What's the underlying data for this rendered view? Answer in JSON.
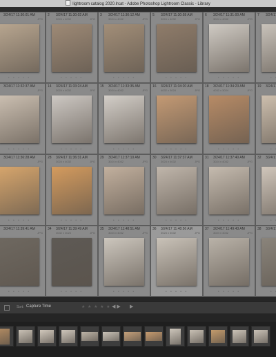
{
  "window": {
    "title": "lightroom catalog 2020.lrcat - Adobe Photoshop Lightroom Classic - Library"
  },
  "grid": {
    "cells": [
      {
        "num": "1",
        "date": "3/24/17 11:30:01 AM",
        "sub": "",
        "fmt": "JPG",
        "thumb": "bust-relief-icon",
        "color": "#b7a58f",
        "selected": false
      },
      {
        "num": "2",
        "date": "3/24/17 11:30:02 AM",
        "sub": "3024 x 4032",
        "fmt": "JPG",
        "thumb": "embracing-sculpture-icon",
        "color": "#9e8a76",
        "selected": false
      },
      {
        "num": "3",
        "date": "3/24/17 11:30:12 AM",
        "sub": "3024 x 4032",
        "fmt": "JPG",
        "thumb": "embracing-sculpture-icon",
        "color": "#a28e78",
        "selected": false
      },
      {
        "num": "5",
        "date": "3/24/17 11:30:58 AM",
        "sub": "3024 x 4032",
        "fmt": "JPG",
        "thumb": "marble-head-icon",
        "color": "#8f7c6a",
        "selected": false
      },
      {
        "num": "6",
        "date": "3/24/17 11:31:00 AM",
        "sub": "3024 x 4032",
        "fmt": "JPG",
        "thumb": "marble-bust-icon",
        "color": "#cfcac3",
        "selected": false
      },
      {
        "num": "7",
        "date": "3/24/17 11:31:...",
        "sub": "",
        "fmt": "",
        "thumb": "marble-bust-icon",
        "color": "#c8c2ba",
        "selected": false
      },
      {
        "num": "13",
        "date": "3/24/17 11:32:37 AM",
        "sub": "",
        "fmt": "JPG",
        "thumb": "bearded-torso-icon",
        "color": "#cbbfb1",
        "selected": false
      },
      {
        "num": "14",
        "date": "3/24/17 11:33:24 AM",
        "sub": "3024 x 4032",
        "fmt": "JPG",
        "thumb": "bronze-griffin-icon",
        "color": "#cdc8c3",
        "selected": false
      },
      {
        "num": "15",
        "date": "3/24/17 11:33:35 AM",
        "sub": "3024 x 4032",
        "fmt": "JPG",
        "thumb": "bronze-griffin-icon",
        "color": "#d3cec8",
        "selected": false
      },
      {
        "num": "16",
        "date": "3/24/17 11:34:20 AM",
        "sub": "4032 x 3024",
        "fmt": "JPG",
        "thumb": "bronze-helmet-icon",
        "color": "#c49a74",
        "selected": false
      },
      {
        "num": "18",
        "date": "3/24/17 11:34:23 AM",
        "sub": "4032 x 3024",
        "fmt": "JPG",
        "thumb": "bronze-helmet-icon",
        "color": "#b78b66",
        "selected": false
      },
      {
        "num": "19",
        "date": "3/24/17 11:...",
        "sub": "",
        "fmt": "",
        "thumb": "marble-torso-icon",
        "color": "#cdbfae",
        "selected": false
      },
      {
        "num": "27",
        "date": "3/24/17 11:36:28 AM",
        "sub": "",
        "fmt": "JPG",
        "thumb": "bronze-head-icon",
        "color": "#d6a56c",
        "selected": false
      },
      {
        "num": "28",
        "date": "3/24/17 11:36:31 AM",
        "sub": "3024 x 4032",
        "fmt": "JPG",
        "thumb": "bronze-head-icon",
        "color": "#d49b5e",
        "selected": false
      },
      {
        "num": "29",
        "date": "3/24/17 11:37:10 AM",
        "sub": "3024 x 4032",
        "fmt": "JPG",
        "thumb": "marble-profile-icon",
        "color": "#c2b09e",
        "selected": false
      },
      {
        "num": "30",
        "date": "3/24/17 11:37:37 AM",
        "sub": "3024 x 4032",
        "fmt": "JPG",
        "thumb": "marble-statue-icon",
        "color": "#c0b6ab",
        "selected": false
      },
      {
        "num": "31",
        "date": "3/24/17 11:37:40 AM",
        "sub": "3024 x 4032",
        "fmt": "JPG",
        "thumb": "marble-statue-icon",
        "color": "#c5bbaf",
        "selected": false
      },
      {
        "num": "32",
        "date": "3/24/17 11:...",
        "sub": "",
        "fmt": "",
        "thumb": "marble-statue-icon",
        "color": "#d0c6bb",
        "selected": false
      },
      {
        "num": "33",
        "date": "3/24/17 11:39:41 AM",
        "sub": "",
        "fmt": "JPG",
        "thumb": "stone-stele-icon",
        "color": "#6e6860",
        "selected": false
      },
      {
        "num": "34",
        "date": "3/24/17 11:39:49 AM",
        "sub": "4032 x 3024",
        "fmt": "JPG",
        "thumb": "stone-stele-icon",
        "color": "#5e5a55",
        "selected": false
      },
      {
        "num": "35",
        "date": "3/24/17 11:48:51 AM",
        "sub": "3024 x 4032",
        "fmt": "JPG",
        "thumb": "portrait-bust-icon",
        "color": "#ccc6bd",
        "selected": false
      },
      {
        "num": "36",
        "date": "3/24/17 11:48:56 AM",
        "sub": "3024 x 4032",
        "fmt": "JPG",
        "thumb": "portrait-bust-icon",
        "color": "#c9c2b8",
        "selected": true
      },
      {
        "num": "37",
        "date": "3/24/17 11:49:43 AM",
        "sub": "3024 x 4032",
        "fmt": "JPG",
        "thumb": "portrait-bust-icon",
        "color": "#b9b2a8",
        "selected": false
      },
      {
        "num": "38",
        "date": "3/24/17 11:...",
        "sub": "",
        "fmt": "",
        "thumb": "gallery-interior-icon",
        "color": "#8a847b",
        "selected": false
      }
    ]
  },
  "toolbar": {
    "sort_label": "Sort:",
    "sort_value": "Capture Time",
    "stars": "★ ★ ★ ★ ★",
    "prev_next": "◀ ▶",
    "play": "▶"
  },
  "filmstrip": {
    "thumbs": [
      {
        "name": "filmstrip-thumb",
        "color": "#b08a62",
        "shape": "tall"
      },
      {
        "name": "filmstrip-thumb",
        "color": "#c9c1b5",
        "shape": "sq"
      },
      {
        "name": "filmstrip-thumb",
        "color": "#d1c8bc",
        "shape": "sq"
      },
      {
        "name": "filmstrip-thumb",
        "color": "#cec6bb",
        "shape": "sq"
      },
      {
        "name": "filmstrip-thumb",
        "color": "#bdb4a7",
        "shape": "wide"
      },
      {
        "name": "filmstrip-thumb",
        "color": "#c9c2b7",
        "shape": "wide"
      },
      {
        "name": "filmstrip-thumb",
        "color": "#c4a07a",
        "shape": "wide"
      },
      {
        "name": "filmstrip-thumb",
        "color": "#c69b6f",
        "shape": "wide"
      },
      {
        "name": "filmstrip-thumb",
        "color": "#cdc6bb",
        "shape": "tall"
      },
      {
        "name": "filmstrip-thumb",
        "color": "#c8c0b4",
        "shape": "sq"
      },
      {
        "name": "filmstrip-thumb",
        "color": "#c29a6c",
        "shape": "sq"
      },
      {
        "name": "filmstrip-thumb",
        "color": "#cbc3b7",
        "shape": "sq"
      },
      {
        "name": "filmstrip-thumb",
        "color": "#c9c1b6",
        "shape": "sq"
      }
    ]
  }
}
